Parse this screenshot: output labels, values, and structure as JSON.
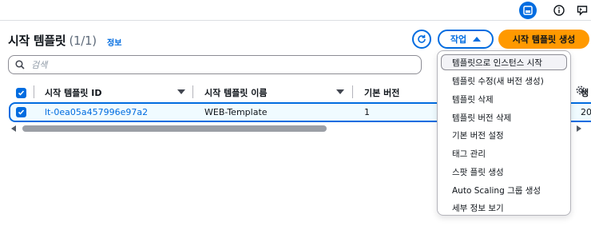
{
  "topbar": {
    "icons": [
      "panel-icon",
      "info-icon",
      "feedback-icon"
    ],
    "accent_color": "#006ce0"
  },
  "header": {
    "title": "시작 템플릿",
    "count": "(1/1)",
    "info_link": "정보",
    "actions_label": "작업",
    "create_label": "시작 템플릿 생성",
    "create_color": "#ff9900"
  },
  "search": {
    "placeholder": "검색",
    "value": ""
  },
  "table": {
    "columns": [
      "시작 템플릿 ID",
      "시작 템플릿 이름",
      "기본 버전",
      "생"
    ],
    "rows": [
      {
        "id": "lt-0ea05a457996e97a2",
        "name": "WEB-Template",
        "default_version": "1",
        "created": "20",
        "selected": true
      }
    ]
  },
  "actions_menu": {
    "items": [
      "템플릿으로 인스턴스 시작",
      "템플릿 수정(새 버전 생성)",
      "템플릿 삭제",
      "템플릿 버전 삭제",
      "기본 버전 설정",
      "태그 관리",
      "스팟 플릿 생성",
      "Auto Scaling 그룹 생성",
      "세부 정보 보기"
    ],
    "highlighted_index": 0
  }
}
